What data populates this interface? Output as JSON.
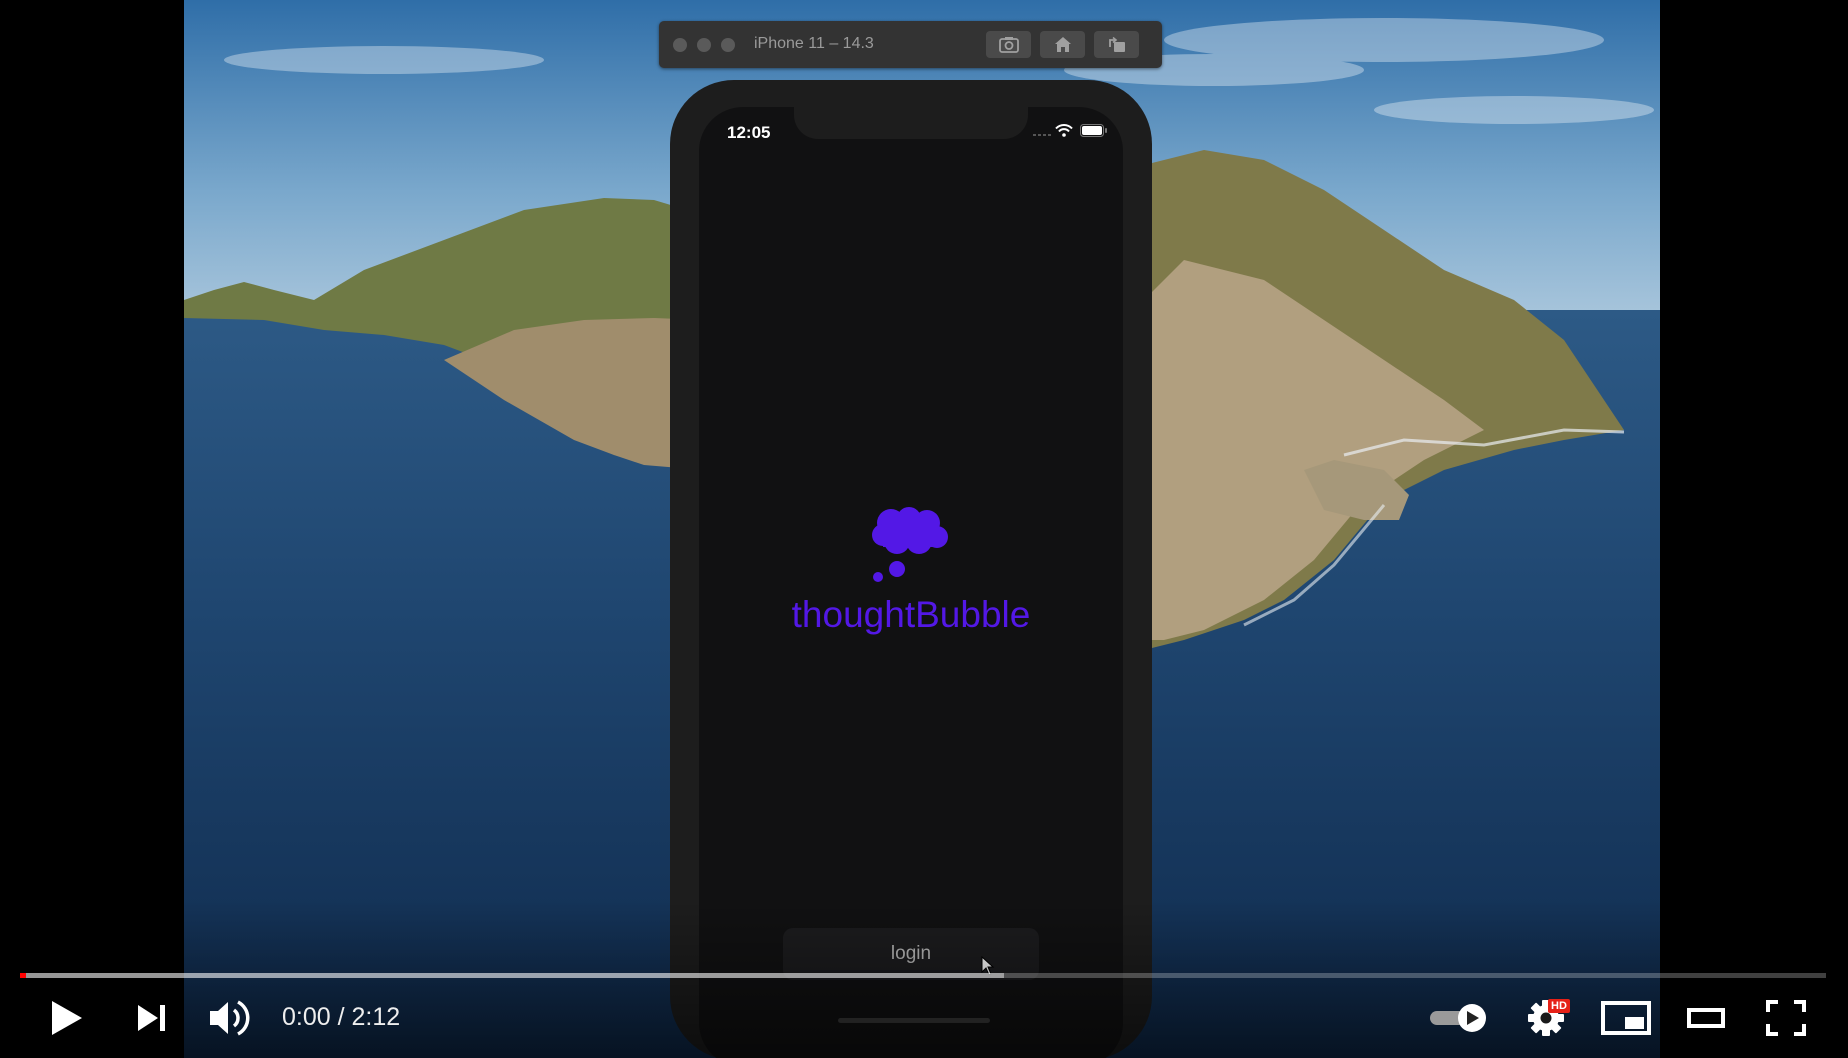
{
  "simulator": {
    "title": "iPhone 11 – 14.3",
    "buttons": [
      "screenshot-icon",
      "home-icon",
      "rotate-icon"
    ]
  },
  "phone": {
    "status_time": "12:05",
    "app_name": "thoughtBubble",
    "login_label": "login",
    "brand_color": "#5318e6"
  },
  "player": {
    "time_display": "0:00 / 2:12",
    "quality_badge": "HD",
    "played_fraction": 0.0,
    "loaded_fraction": 0.545,
    "controls": [
      "play-icon",
      "next-icon",
      "volume-icon",
      "autoplay-toggle",
      "settings-icon",
      "miniplayer-icon",
      "theater-icon",
      "fullscreen-icon"
    ]
  }
}
